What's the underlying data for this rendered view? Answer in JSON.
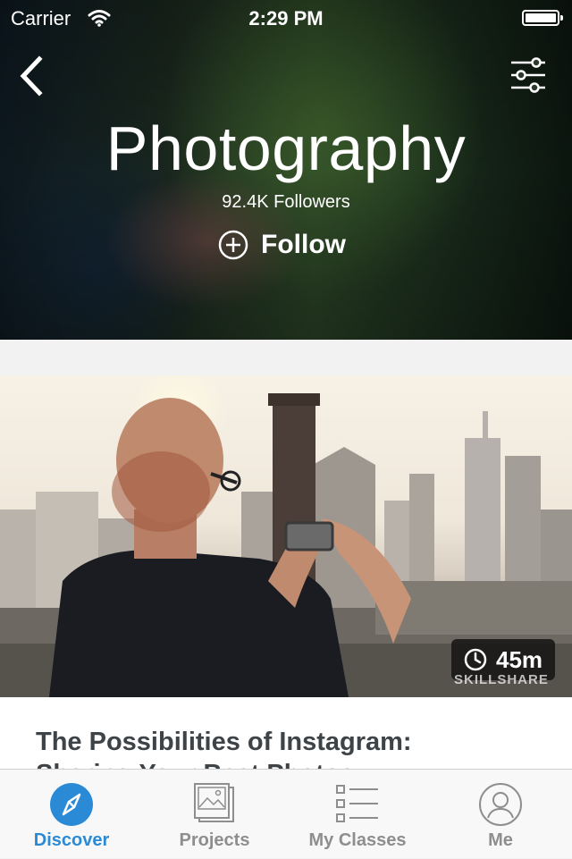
{
  "status_bar": {
    "carrier": "Carrier",
    "time": "2:29 PM"
  },
  "header": {
    "title": "Photography",
    "followers": "92.4K Followers",
    "follow_label": "Follow"
  },
  "class_card": {
    "duration": "45m",
    "watermark": "SKILLSHARE",
    "title": "The Possibilities of Instagram:",
    "subtitle_partial": "Sharing Your Best Photos"
  },
  "tabbar": {
    "items": [
      {
        "label": "Discover",
        "icon": "compass-icon",
        "active": true
      },
      {
        "label": "Projects",
        "icon": "photos-icon",
        "active": false
      },
      {
        "label": "My Classes",
        "icon": "list-icon",
        "active": false
      },
      {
        "label": "Me",
        "icon": "user-icon",
        "active": false
      }
    ]
  },
  "colors": {
    "accent": "#2b8ad6",
    "inactive": "#8e8e8e"
  }
}
